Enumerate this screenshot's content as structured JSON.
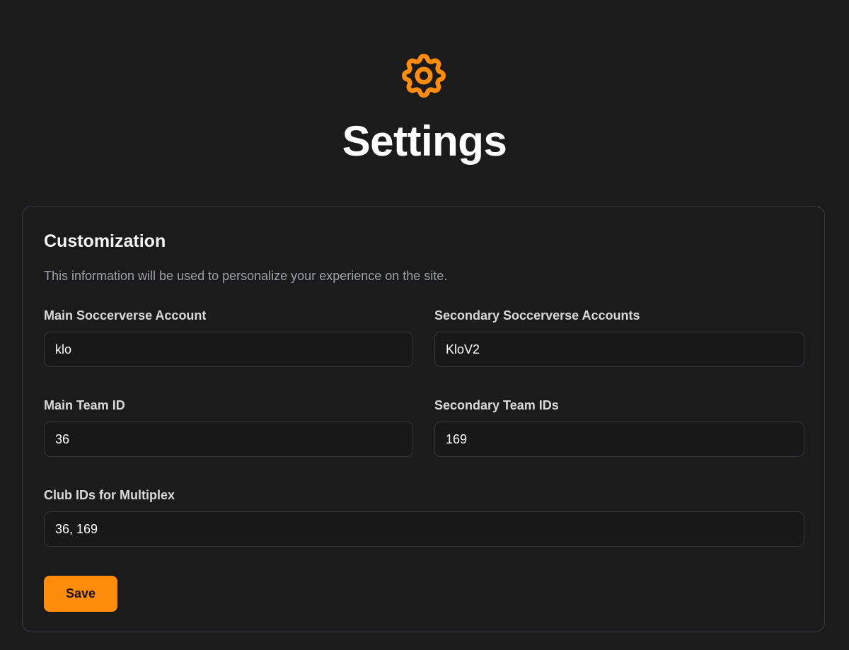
{
  "header": {
    "icon": "gear-icon",
    "title": "Settings"
  },
  "colors": {
    "background": "#1b1b1b",
    "accent": "#ff8d0b",
    "card_border": "#3a3d44"
  },
  "card": {
    "title": "Customization",
    "description": "This information will be used to personalize your experience on the site.",
    "fields": {
      "main_account": {
        "label": "Main Soccerverse Account",
        "value": "klo"
      },
      "secondary_accounts": {
        "label": "Secondary Soccerverse Accounts",
        "value": "KloV2"
      },
      "main_team_id": {
        "label": "Main Team ID",
        "value": "36"
      },
      "secondary_team_ids": {
        "label": "Secondary Team IDs",
        "value": "169"
      },
      "multiplex_club_ids": {
        "label": "Club IDs for Multiplex",
        "value": "36, 169"
      }
    },
    "save_label": "Save"
  }
}
